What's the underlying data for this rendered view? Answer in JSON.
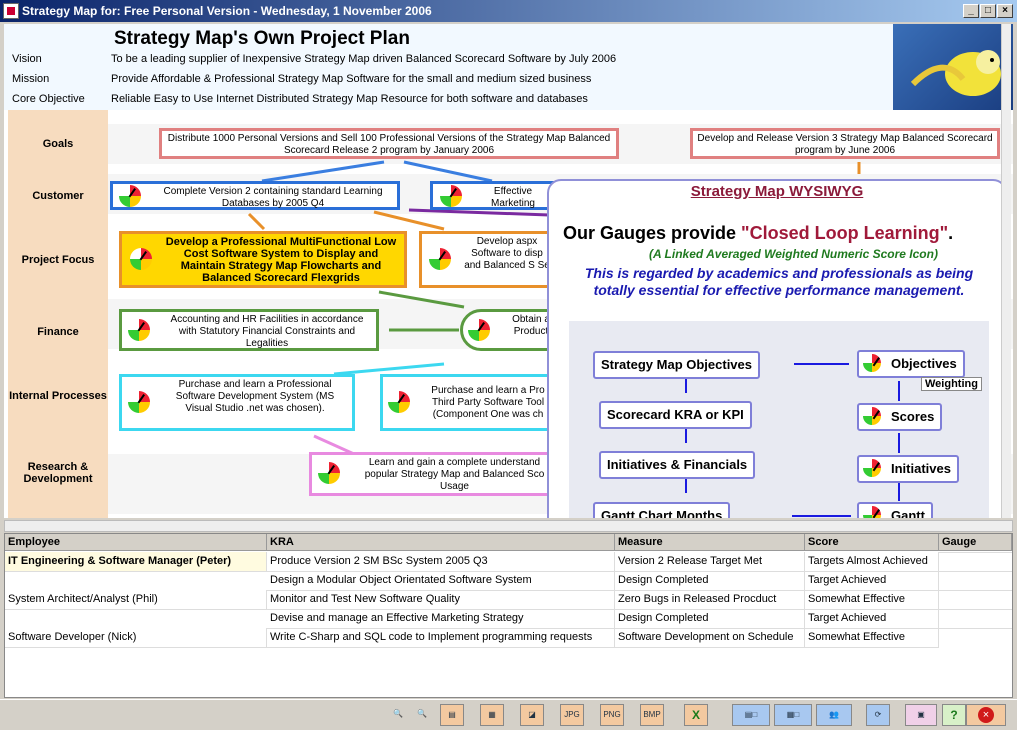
{
  "window": {
    "title": "Strategy Map for: Free Personal Version - Wednesday, 1 November 2006"
  },
  "header": {
    "title": "Strategy Map's Own Project Plan",
    "vision_label": "Vision",
    "vision": "To be a leading supplier of Inexpensive Strategy Map driven Balanced Scorecard Software by July 2006",
    "mission_label": "Mission",
    "mission": "Provide Affordable & Professional Strategy Map Software for the small and medium sized business",
    "core_label": "Core Objective",
    "core": "Reliable Easy to Use Internet Distributed Strategy Map Resource for both software and databases"
  },
  "rows": {
    "goals": "Goals",
    "customer": "Customer",
    "project_focus": "Project Focus",
    "finance": "Finance",
    "internal": "Internal Processes",
    "research": "Research & Development"
  },
  "objectives": {
    "goal1": "Distribute 1000 Personal Versions and Sell 100 Professional Versions of the Strategy Map Balanced Scorecard Release 2 program by January 2006",
    "goal2": "Develop and Release Version 3 Strategy Map Balanced Scorecard program by June 2006",
    "cust1": "Complete Version 2 containing standard Learning Databases by 2005 Q4",
    "cust2": "Effective Marketing",
    "pf1": "Develop a Professional MultiFunctional Low Cost Software System to Display and Maintain Strategy Map Flowcharts and Balanced Scorecard Flexgrids",
    "pf2": "Develop aspx Software to disp and Balanced S Se",
    "fin1": "Accounting and HR Facilities in accordance with Statutory Financial Constraints and Legalities",
    "fin2": "Obtain a Product",
    "ip1": "Purchase and learn a Professional Software Development System (MS Visual Studio .net was chosen).",
    "ip2": "Purchase and learn a Pro Third Party Software Tool (Component One was ch",
    "rd1": "Learn and gain a complete understand popular Strategy Map and Balanced Sco Usage"
  },
  "popup": {
    "title": "Strategy Map WYSIWYG",
    "headline_a": "Our Gauges provide ",
    "headline_b": "\"Closed Loop Learning\"",
    "headline_c": ".",
    "sub": "(A Linked Averaged Weighted Numeric Score Icon)",
    "blurb": "This is regarded by academics and professionals as being totally essential for effective performance management.",
    "left_boxes": [
      "Strategy Map Objectives",
      "Scorecard KRA or KPI",
      "Initiatives & Financials",
      "Gantt Chart Months"
    ],
    "right_boxes": [
      "Objectives",
      "Scores",
      "Initiatives",
      "Gantt"
    ],
    "weighting": "Weighting"
  },
  "grid": {
    "columns": [
      "Employee",
      "KRA",
      "Measure",
      "Score",
      "Gauge"
    ],
    "rows": [
      {
        "employee": "IT Engineering & Software Manager (Peter)",
        "kra": "Produce Version 2 SM BSc System 2005 Q3",
        "measure": "Version 2 Release Target Met",
        "score": "Targets Almost Achieved"
      },
      {
        "employee": "",
        "kra": "Design a Modular Object Orientated Software System",
        "measure": "Design Completed",
        "score": "Target Achieved"
      },
      {
        "employee": "System Architect/Analyst (Phil)",
        "kra": "Monitor and Test New Software Quality",
        "measure": "Zero Bugs in Released Procduct",
        "score": "Somewhat Effective"
      },
      {
        "employee": "",
        "kra": "Devise and manage an Effective Marketing Strategy",
        "measure": "Design Completed",
        "score": "Target Achieved"
      },
      {
        "employee": "Software Developer (Nick)",
        "kra": "Write C-Sharp and SQL code to Implement programming requests",
        "measure": "Software Development on Schedule",
        "score": "Somewhat Effective"
      }
    ]
  },
  "toolbar": {
    "help": "?"
  },
  "colors": {
    "accent": "#0a246a",
    "goal_border": "#e08080",
    "customer_border": "#2a6fd8",
    "focus_fill": "#ffd700"
  }
}
